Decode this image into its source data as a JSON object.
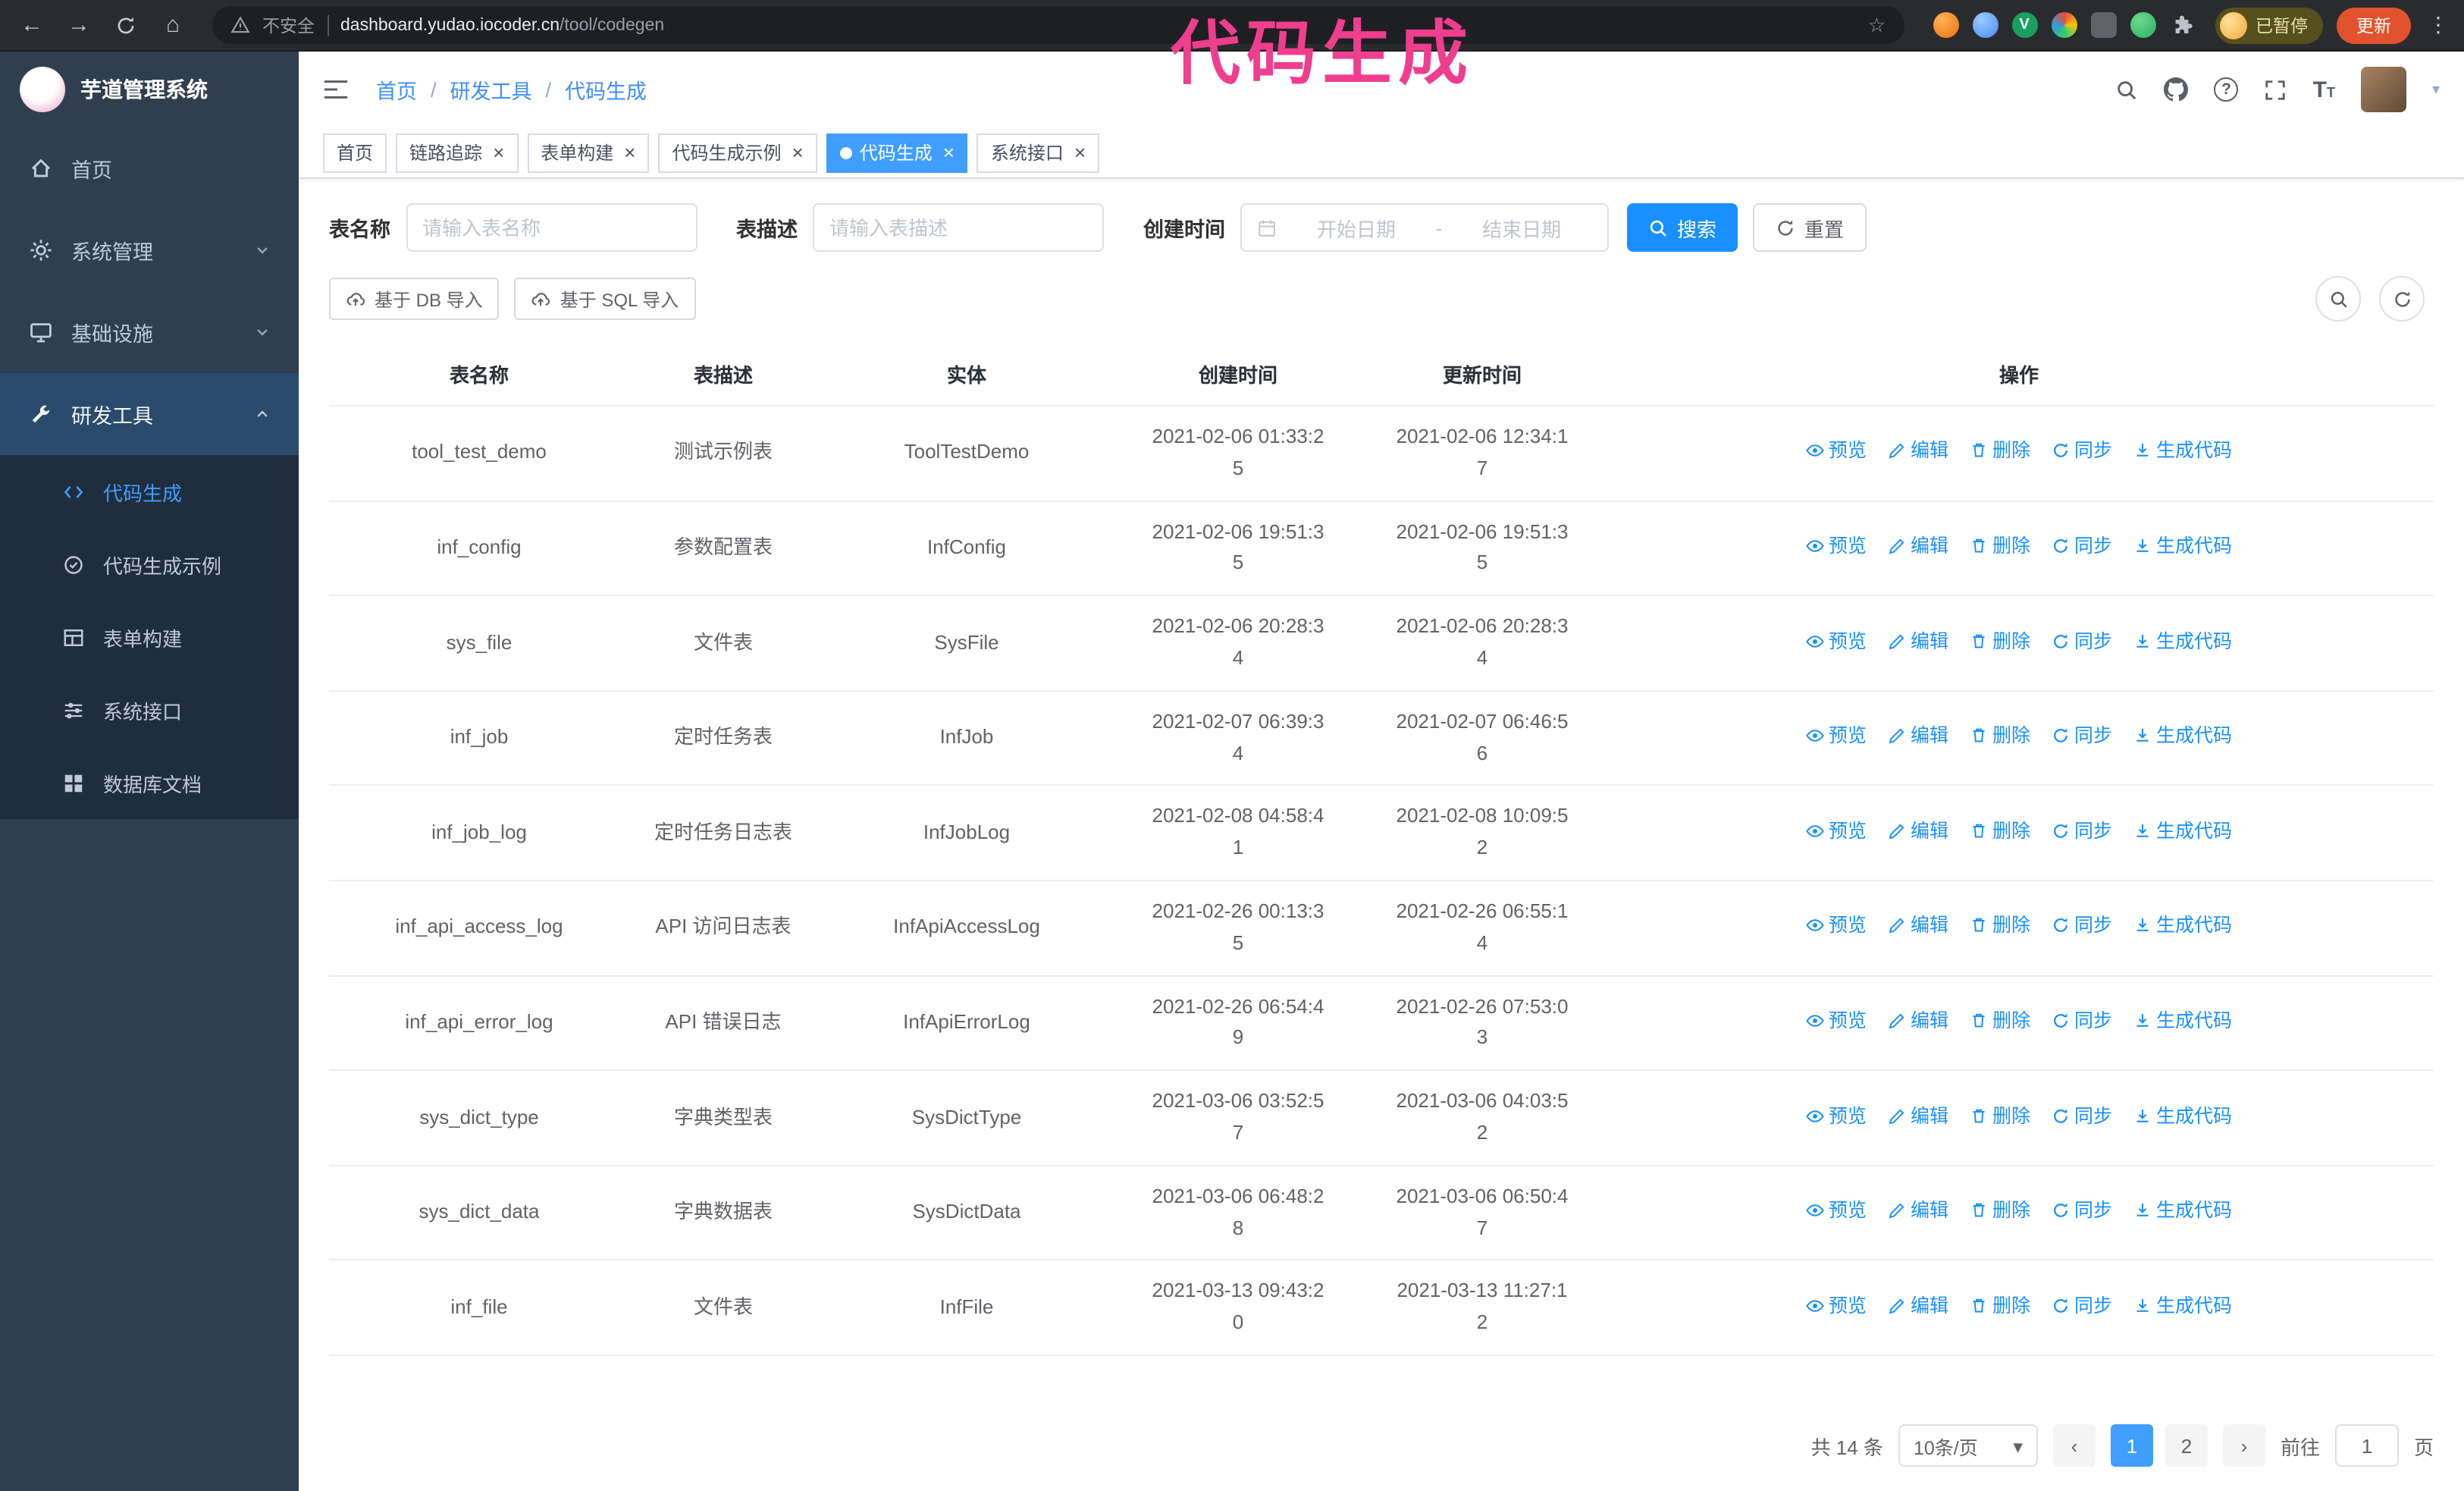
{
  "icons": {
    "back": "←",
    "forward": "→",
    "home_glyph": "⌂",
    "star": "☆",
    "kebab": "⋮",
    "caret_down": "▾",
    "prev": "‹",
    "next": "›",
    "close": "×",
    "separator": "/",
    "question": "?",
    "font_large": "T",
    "font_small": "T",
    "vue_v": "V"
  },
  "annotation": {
    "text": "代码生成"
  },
  "browser": {
    "security_label": "不安全",
    "url_host": "dashboard.yudao.iocoder.cn",
    "url_path": "/tool/codegen",
    "paused_badge": "已暂停",
    "update_button": "更新"
  },
  "sidebar": {
    "logo_title": "芋道管理系统",
    "items": [
      {
        "id": "home",
        "label": "首页",
        "icon": "home"
      },
      {
        "id": "system",
        "label": "系统管理",
        "icon": "gear",
        "arrow": "down"
      },
      {
        "id": "infra",
        "label": "基础设施",
        "icon": "monitor",
        "arrow": "down"
      },
      {
        "id": "devtools",
        "label": "研发工具",
        "icon": "wrench",
        "arrow": "up",
        "active": true,
        "expanded": true
      }
    ],
    "subitems": [
      {
        "id": "codegen",
        "label": "代码生成",
        "icon": "code",
        "active": true
      },
      {
        "id": "codegen-example",
        "label": "代码生成示例",
        "icon": "badge"
      },
      {
        "id": "form-builder",
        "label": "表单构建",
        "icon": "form"
      },
      {
        "id": "api",
        "label": "系统接口",
        "icon": "sliders"
      },
      {
        "id": "db-doc",
        "label": "数据库文档",
        "icon": "grid"
      }
    ]
  },
  "header": {
    "breadcrumb": [
      "首页",
      "研发工具",
      "代码生成"
    ]
  },
  "tabs": [
    {
      "label": "首页",
      "closable": false,
      "active": false
    },
    {
      "label": "链路追踪",
      "closable": true,
      "active": false
    },
    {
      "label": "表单构建",
      "closable": true,
      "active": false
    },
    {
      "label": "代码生成示例",
      "closable": true,
      "active": false
    },
    {
      "label": "代码生成",
      "closable": true,
      "active": true
    },
    {
      "label": "系统接口",
      "closable": true,
      "active": false
    }
  ],
  "filters": {
    "table_name_label": "表名称",
    "table_name_placeholder": "请输入表名称",
    "table_desc_label": "表描述",
    "table_desc_placeholder": "请输入表描述",
    "create_time_label": "创建时间",
    "date_start_placeholder": "开始日期",
    "date_range_separator": "-",
    "date_end_placeholder": "结束日期",
    "search_button": "搜索",
    "reset_button": "重置"
  },
  "toolbar": {
    "import_db_button": "基于 DB 导入",
    "import_sql_button": "基于 SQL 导入"
  },
  "table": {
    "columns": [
      "表名称",
      "表描述",
      "实体",
      "创建时间",
      "更新时间",
      "操作"
    ],
    "action_labels": [
      "预览",
      "编辑",
      "删除",
      "同步",
      "生成代码"
    ],
    "rows": [
      {
        "name": "tool_test_demo",
        "desc": "测试示例表",
        "entity": "ToolTestDemo",
        "created": "2021-02-06 01:33:25",
        "updated": "2021-02-06 12:34:17"
      },
      {
        "name": "inf_config",
        "desc": "参数配置表",
        "entity": "InfConfig",
        "created": "2021-02-06 19:51:35",
        "updated": "2021-02-06 19:51:35"
      },
      {
        "name": "sys_file",
        "desc": "文件表",
        "entity": "SysFile",
        "created": "2021-02-06 20:28:34",
        "updated": "2021-02-06 20:28:34"
      },
      {
        "name": "inf_job",
        "desc": "定时任务表",
        "entity": "InfJob",
        "created": "2021-02-07 06:39:34",
        "updated": "2021-02-07 06:46:56"
      },
      {
        "name": "inf_job_log",
        "desc": "定时任务日志表",
        "entity": "InfJobLog",
        "created": "2021-02-08 04:58:41",
        "updated": "2021-02-08 10:09:52"
      },
      {
        "name": "inf_api_access_log",
        "desc": "API 访问日志表",
        "entity": "InfApiAccessLog",
        "created": "2021-02-26 00:13:35",
        "updated": "2021-02-26 06:55:14"
      },
      {
        "name": "inf_api_error_log",
        "desc": "API 错误日志",
        "entity": "InfApiErrorLog",
        "created": "2021-02-26 06:54:49",
        "updated": "2021-02-26 07:53:03"
      },
      {
        "name": "sys_dict_type",
        "desc": "字典类型表",
        "entity": "SysDictType",
        "created": "2021-03-06 03:52:57",
        "updated": "2021-03-06 04:03:52"
      },
      {
        "name": "sys_dict_data",
        "desc": "字典数据表",
        "entity": "SysDictData",
        "created": "2021-03-06 06:48:28",
        "updated": "2021-03-06 06:50:47"
      },
      {
        "name": "inf_file",
        "desc": "文件表",
        "entity": "InfFile",
        "created": "2021-03-13 09:43:20",
        "updated": "2021-03-13 11:27:12"
      }
    ]
  },
  "pagination": {
    "total": "共 14 条",
    "page_size": "10条/页",
    "pages": [
      "1",
      "2"
    ],
    "active_page": "1",
    "goto_label": "前往",
    "goto_value": "1",
    "goto_suffix": "页"
  }
}
